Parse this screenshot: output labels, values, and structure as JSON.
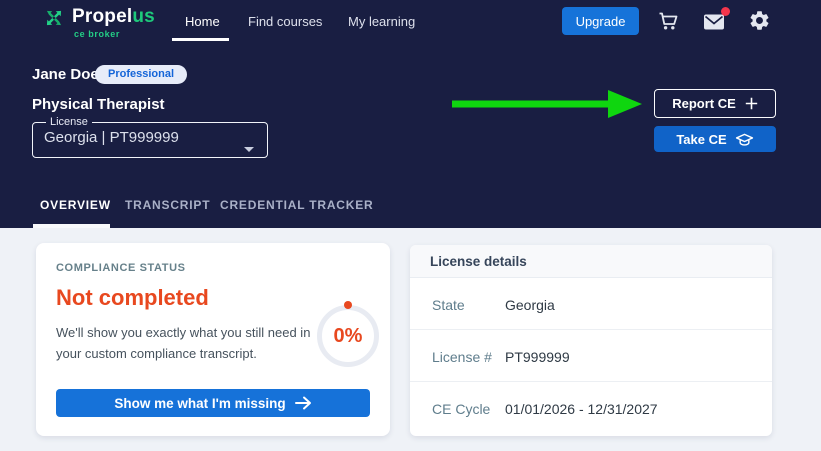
{
  "brand": {
    "name_white": "Propel",
    "name_green": "us",
    "tagline": "ce broker"
  },
  "navbar": {
    "items": [
      {
        "label": "Home",
        "active": true
      },
      {
        "label": "Find courses",
        "active": false
      },
      {
        "label": "My learning",
        "active": false
      }
    ],
    "upgrade_label": "Upgrade",
    "mail_has_notification": true
  },
  "hero": {
    "user_name": "Jane Doe",
    "badge": "Professional",
    "profession": "Physical Therapist",
    "license_field": {
      "label": "License",
      "value": "Georgia | PT999999"
    },
    "report_ce_label": "Report CE",
    "take_ce_label": "Take CE"
  },
  "tabs": [
    {
      "label": "OVERVIEW",
      "active": true
    },
    {
      "label": "TRANSCRIPT",
      "active": false
    },
    {
      "label": "CREDENTIAL TRACKER",
      "active": false
    }
  ],
  "compliance_card": {
    "section_label": "COMPLIANCE STATUS",
    "status": "Not completed",
    "description": "We'll show you exactly what you still need in your custom compliance transcript.",
    "progress_percent": "0%",
    "cta_label": "Show me what I'm missing"
  },
  "license_details_card": {
    "title": "License details",
    "rows": [
      {
        "label": "State",
        "value": "Georgia"
      },
      {
        "label": "License #",
        "value": "PT999999"
      },
      {
        "label": "CE Cycle",
        "value": "01/01/2026 - 12/31/2027"
      }
    ]
  },
  "colors": {
    "navy_bg": "#191E42",
    "primary_blue": "#1673D9",
    "take_ce_blue": "#1063C8",
    "brand_green": "#1EC97B",
    "arrow_green": "#0FD60F",
    "alert_orange": "#E8481F",
    "badge_text_blue": "#1565D8",
    "muted_label": "#66808A",
    "content_bg": "#EFF2F7",
    "notification_red": "#F4364C"
  }
}
